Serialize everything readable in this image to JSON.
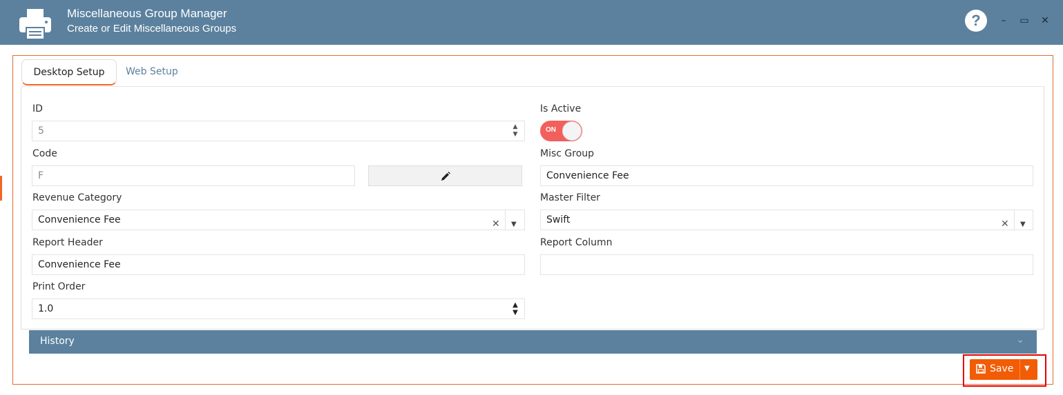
{
  "window": {
    "title": "Miscellaneous Group Manager",
    "subtitle": "Create or Edit Miscellaneous Groups",
    "help_symbol": "?",
    "minimize_symbol": "–",
    "maximize_symbol": "▭",
    "close_symbol": "✕",
    "app_icon": "printer-icon",
    "titlebar_color": "#5b819e"
  },
  "tabs": [
    {
      "label": "Desktop Setup",
      "active": true
    },
    {
      "label": "Web Setup",
      "active": false
    }
  ],
  "form": {
    "id": {
      "label": "ID",
      "value": "5"
    },
    "is_active": {
      "label": "Is Active",
      "state": "ON"
    },
    "code": {
      "label": "Code",
      "value": "F"
    },
    "misc_group": {
      "label": "Misc Group",
      "value": "Convenience Fee"
    },
    "revenue_category": {
      "label": "Revenue Category",
      "value": "Convenience Fee"
    },
    "master_filter": {
      "label": "Master Filter",
      "value": "Swift"
    },
    "report_header": {
      "label": "Report Header",
      "value": "Convenience Fee"
    },
    "report_column": {
      "label": "Report Column",
      "value": ""
    },
    "print_order": {
      "label": "Print Order",
      "value": "1.0"
    }
  },
  "history": {
    "label": "History"
  },
  "actions": {
    "save_label": "Save",
    "save_color": "#f25c05"
  }
}
